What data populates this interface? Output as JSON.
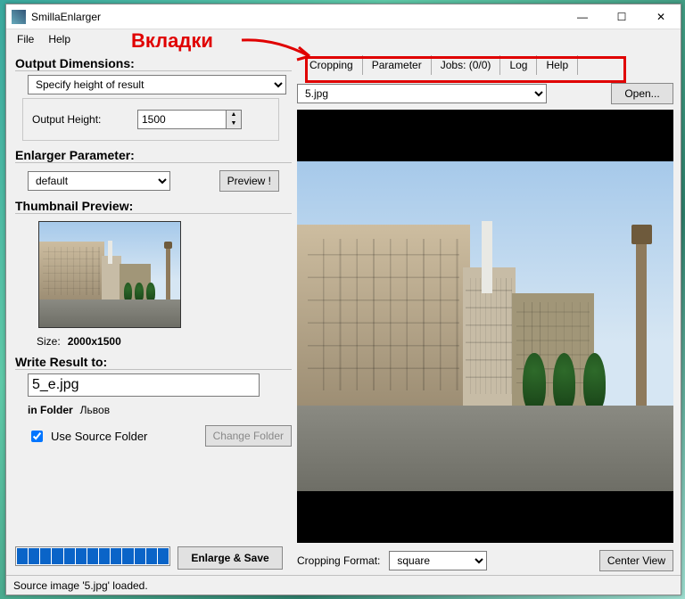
{
  "annotation": {
    "label": "Вкладки"
  },
  "titlebar": {
    "title": "SmillaEnlarger"
  },
  "menubar": {
    "file": "File",
    "help": "Help"
  },
  "winbuttons": {
    "min": "—",
    "max": "☐",
    "close": "✕"
  },
  "left": {
    "out_dim_heading": "Output Dimensions:",
    "dimension_mode": "Specify height of result",
    "out_height_label": "Output Height:",
    "out_height_value": "1500",
    "enlarger_param_heading": "Enlarger Parameter:",
    "param_preset": "default",
    "preview_btn": "Preview !",
    "thumb_heading": "Thumbnail Preview:",
    "size_label": "Size:",
    "size_value": "2000x1500",
    "write_heading": "Write Result to:",
    "outfile": "5_e.jpg",
    "in_folder_label": "in Folder",
    "folder_name": "Львов",
    "use_src_folder": "Use Source Folder",
    "change_folder_btn": "Change Folder",
    "enlarge_btn": "Enlarge & Save"
  },
  "right": {
    "tabs": {
      "cropping": "Cropping",
      "parameter": "Parameter",
      "jobs": "Jobs: (0/0)",
      "log": "Log",
      "help": "Help"
    },
    "file": "5.jpg",
    "open_btn": "Open...",
    "crop_fmt_label": "Cropping Format:",
    "crop_fmt_value": "square",
    "center_btn": "Center View"
  },
  "status": "Source image '5.jpg' loaded."
}
